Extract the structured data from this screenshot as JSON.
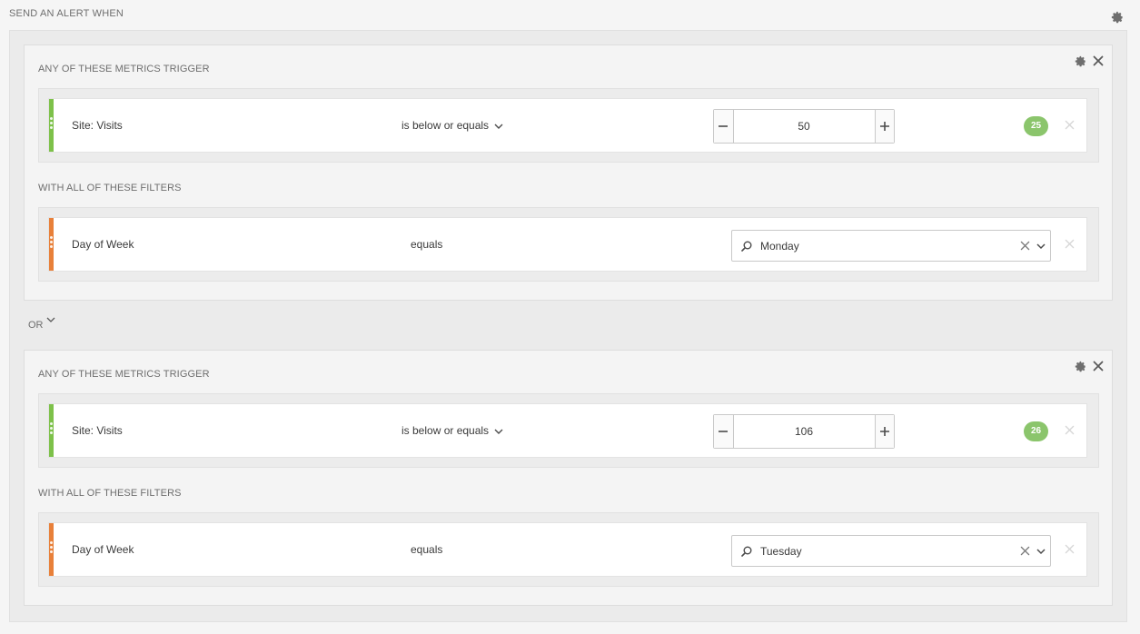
{
  "page": {
    "title": "SEND AN ALERT WHEN",
    "settings_icon": "gear-icon"
  },
  "connector": {
    "label": "OR",
    "icon": "chevron-down-icon"
  },
  "colors": {
    "metric_stripe": "#7dc14a",
    "filter_stripe": "#e8803a",
    "badge": "#8bc56c"
  },
  "groups": [
    {
      "metrics_label": "ANY OF THESE METRICS TRIGGER",
      "filters_label": "WITH ALL OF THESE FILTERS",
      "metric": {
        "name": "Site: Visits",
        "operator": "is below or equals",
        "value": "50",
        "badge": "25"
      },
      "filter": {
        "name": "Day of Week",
        "operator": "equals",
        "value": "Monday"
      }
    },
    {
      "metrics_label": "ANY OF THESE METRICS TRIGGER",
      "filters_label": "WITH ALL OF THESE FILTERS",
      "metric": {
        "name": "Site: Visits",
        "operator": "is below or equals",
        "value": "106",
        "badge": "26"
      },
      "filter": {
        "name": "Day of Week",
        "operator": "equals",
        "value": "Tuesday"
      }
    }
  ]
}
